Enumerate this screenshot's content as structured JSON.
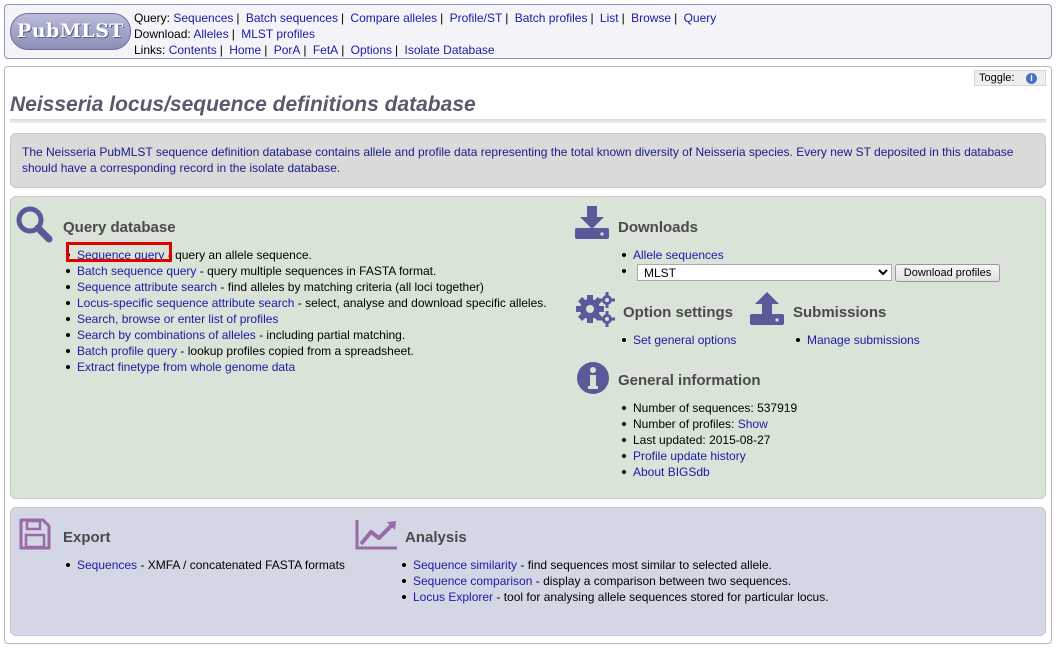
{
  "header": {
    "logo_text": "PubMLST",
    "query_label": "Query:",
    "query_links": [
      "Sequences",
      "Batch sequences",
      "Compare alleles",
      "Profile/ST",
      "Batch profiles",
      "List",
      "Browse",
      "Query"
    ],
    "download_label": "Download:",
    "download_links": [
      "Alleles",
      "MLST profiles"
    ],
    "links_label": "Links:",
    "links_links": [
      "Contents",
      "Home",
      "PorA",
      "FetA",
      "Options",
      "Isolate Database"
    ]
  },
  "toggle_label": "Toggle:",
  "page_title": "Neisseria locus/sequence definitions database",
  "intro_text": "The Neisseria PubMLST sequence definition database contains allele and profile data representing the total known diversity of Neisseria species. Every new ST deposited in this database should have a corresponding record in the isolate database.",
  "query": {
    "heading": "Query database",
    "items": [
      {
        "link": "Sequence query",
        "desc": " - query an allele sequence."
      },
      {
        "link": "Batch sequence query",
        "desc": " - query multiple sequences in FASTA format."
      },
      {
        "link": "Sequence attribute search",
        "desc": " - find alleles by matching criteria (all loci together)"
      },
      {
        "link": "Locus-specific sequence attribute search",
        "desc": " - select, analyse and download specific alleles."
      },
      {
        "link": "Search, browse or enter list of profiles",
        "desc": ""
      },
      {
        "link": "Search by combinations of alleles",
        "desc": " - including partial matching."
      },
      {
        "link": "Batch profile query",
        "desc": " - lookup profiles copied from a spreadsheet."
      },
      {
        "link": "Extract finetype from whole genome data",
        "desc": ""
      }
    ]
  },
  "downloads": {
    "heading": "Downloads",
    "allele_link": "Allele sequences",
    "scheme_selected": "MLST",
    "button_label": "Download profiles"
  },
  "options": {
    "heading": "Option settings",
    "link": "Set general options"
  },
  "submissions": {
    "heading": "Submissions",
    "link": "Manage submissions"
  },
  "general": {
    "heading": "General information",
    "num_sequences_label": "Number of sequences: ",
    "num_sequences": "537919",
    "num_profiles_label": "Number of profiles: ",
    "num_profiles_link": "Show",
    "last_updated_label": "Last updated: ",
    "last_updated": "2015-08-27",
    "history_link": "Profile update history",
    "about_link": "About BIGSdb"
  },
  "export": {
    "heading": "Export",
    "items": [
      {
        "link": "Sequences",
        "desc": " - XMFA / concatenated FASTA formats"
      }
    ]
  },
  "analysis": {
    "heading": "Analysis",
    "items": [
      {
        "link": "Sequence similarity",
        "desc": " - find sequences most similar to selected allele."
      },
      {
        "link": "Sequence comparison",
        "desc": " - display a comparison between two sequences."
      },
      {
        "link": "Locus Explorer",
        "desc": " - tool for analysing allele sequences stored for particular locus."
      }
    ]
  },
  "colors": {
    "link": "#1a1aa6",
    "icon": "#5a5a9a",
    "query_panel_bg": "#d9e3d7",
    "export_panel_bg": "#d3d6e4",
    "highlight": "#e00000"
  }
}
